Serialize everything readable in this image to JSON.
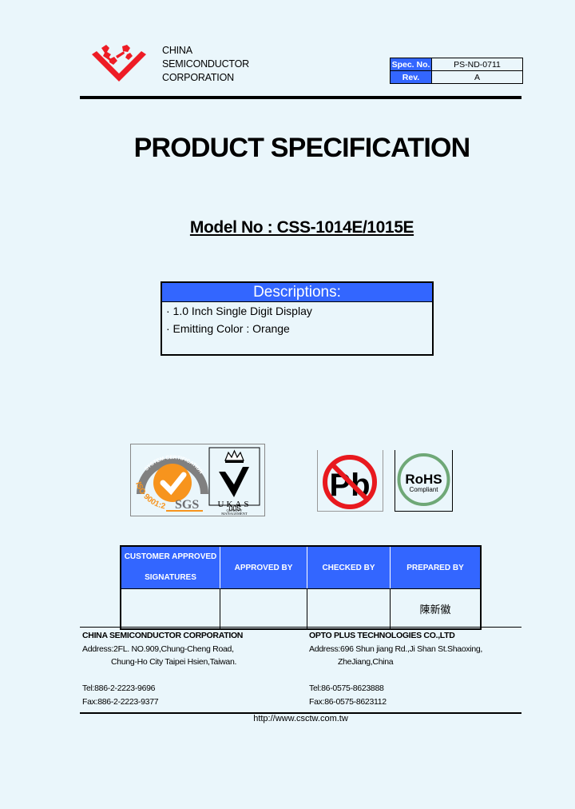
{
  "header": {
    "company_lines": [
      "CHINA",
      "SEMICONDUCTOR",
      "CORPORATION"
    ],
    "logo_icon": "csc-red-chevron-logo",
    "spec_table": [
      {
        "label": "Spec. No.",
        "value": "PS-ND-0711"
      },
      {
        "label": "Rev.",
        "value": "A"
      }
    ]
  },
  "title": "PRODUCT SPECIFICATION",
  "model": "Model No : CSS-1014E/1015E",
  "descriptions": {
    "heading": "Descriptions:",
    "items": [
      "· 1.0 Inch Single Digit Display",
      "· Emitting Color : Orange"
    ]
  },
  "certifications": {
    "iso": {
      "ring_text": "SYSTEM CERTIFICATION",
      "standard": "ISO 9001:2000",
      "brand": "SGS"
    },
    "ukas": {
      "title": "UKAS",
      "subtitle_1": "QUALITY",
      "subtitle_2": "MANAGEMENT",
      "number": "005"
    },
    "pb": {
      "text": "Pb"
    },
    "rohs": {
      "title": "RoHS",
      "subtitle": "Compliant"
    },
    "colors": {
      "sgs_orange": "#f7941d",
      "pb_red": "#e8191e",
      "rohs_green": "#6fa877"
    }
  },
  "signatures": {
    "headers": [
      "CUSTOMER APPROVED SIGNATURES",
      "APPROVED BY",
      "CHECKED BY",
      "PREPARED BY"
    ],
    "header_line_1": "CUSTOMER APPROVED",
    "header_line_2": "SIGNATURES",
    "values": [
      "",
      "",
      "",
      "陳新徽"
    ]
  },
  "footer": {
    "left": {
      "company": "CHINA SEMICONDUCTOR CORPORATION",
      "address_1": "Address:2FL. NO.909,Chung-Cheng Road,",
      "address_2": "Chung-Ho City Taipei Hsien,Taiwan.",
      "tel": "Tel:886-2-2223-9696",
      "fax": "Fax:886-2-2223-9377"
    },
    "right": {
      "company": "OPTO PLUS TECHNOLOGIES CO.,LTD",
      "address_1": "Address:696 Shun jiang Rd.,Ji Shan St.Shaoxing,",
      "address_2": "ZheJiang,China",
      "tel": "Tel:86-0575-8623888",
      "fax": "Fax:86-0575-8623112"
    },
    "url": "http://www.csctw.com.tw"
  },
  "colors": {
    "background": "#eaf6fb",
    "accent_blue": "#3366ff",
    "logo_red": "#ee1c25"
  }
}
